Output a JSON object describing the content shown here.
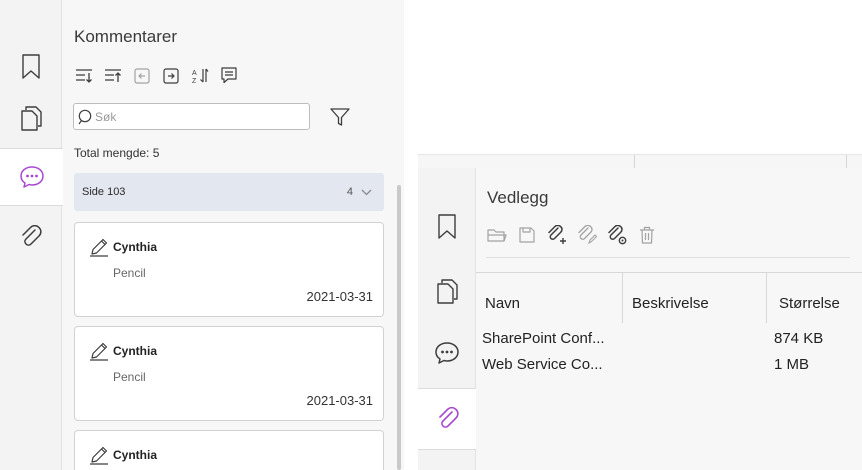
{
  "comments_panel": {
    "title": "Kommentarer",
    "search": {
      "placeholder": "Søk",
      "value": ""
    },
    "total": "Total mengde: 5",
    "group": {
      "label": "Side 103",
      "count": "4"
    },
    "cards": [
      {
        "author": "Cynthia",
        "type": "Pencil",
        "date": "2021-03-31"
      },
      {
        "author": "Cynthia",
        "type": "Pencil",
        "date": "2021-03-31"
      },
      {
        "author": "Cynthia"
      }
    ]
  },
  "attachments_panel": {
    "title": "Vedlegg",
    "columns": {
      "name": "Navn",
      "description": "Beskrivelse",
      "size": "Størrelse"
    },
    "rows": [
      {
        "name": "SharePoint Conf...",
        "description": "",
        "size": "874 KB"
      },
      {
        "name": "Web Service Co...",
        "description": "",
        "size": "1 MB"
      }
    ]
  },
  "colors": {
    "accent": "#a84ad1",
    "icon": "#3d3d3d",
    "group_bg": "#e3e7ef"
  }
}
